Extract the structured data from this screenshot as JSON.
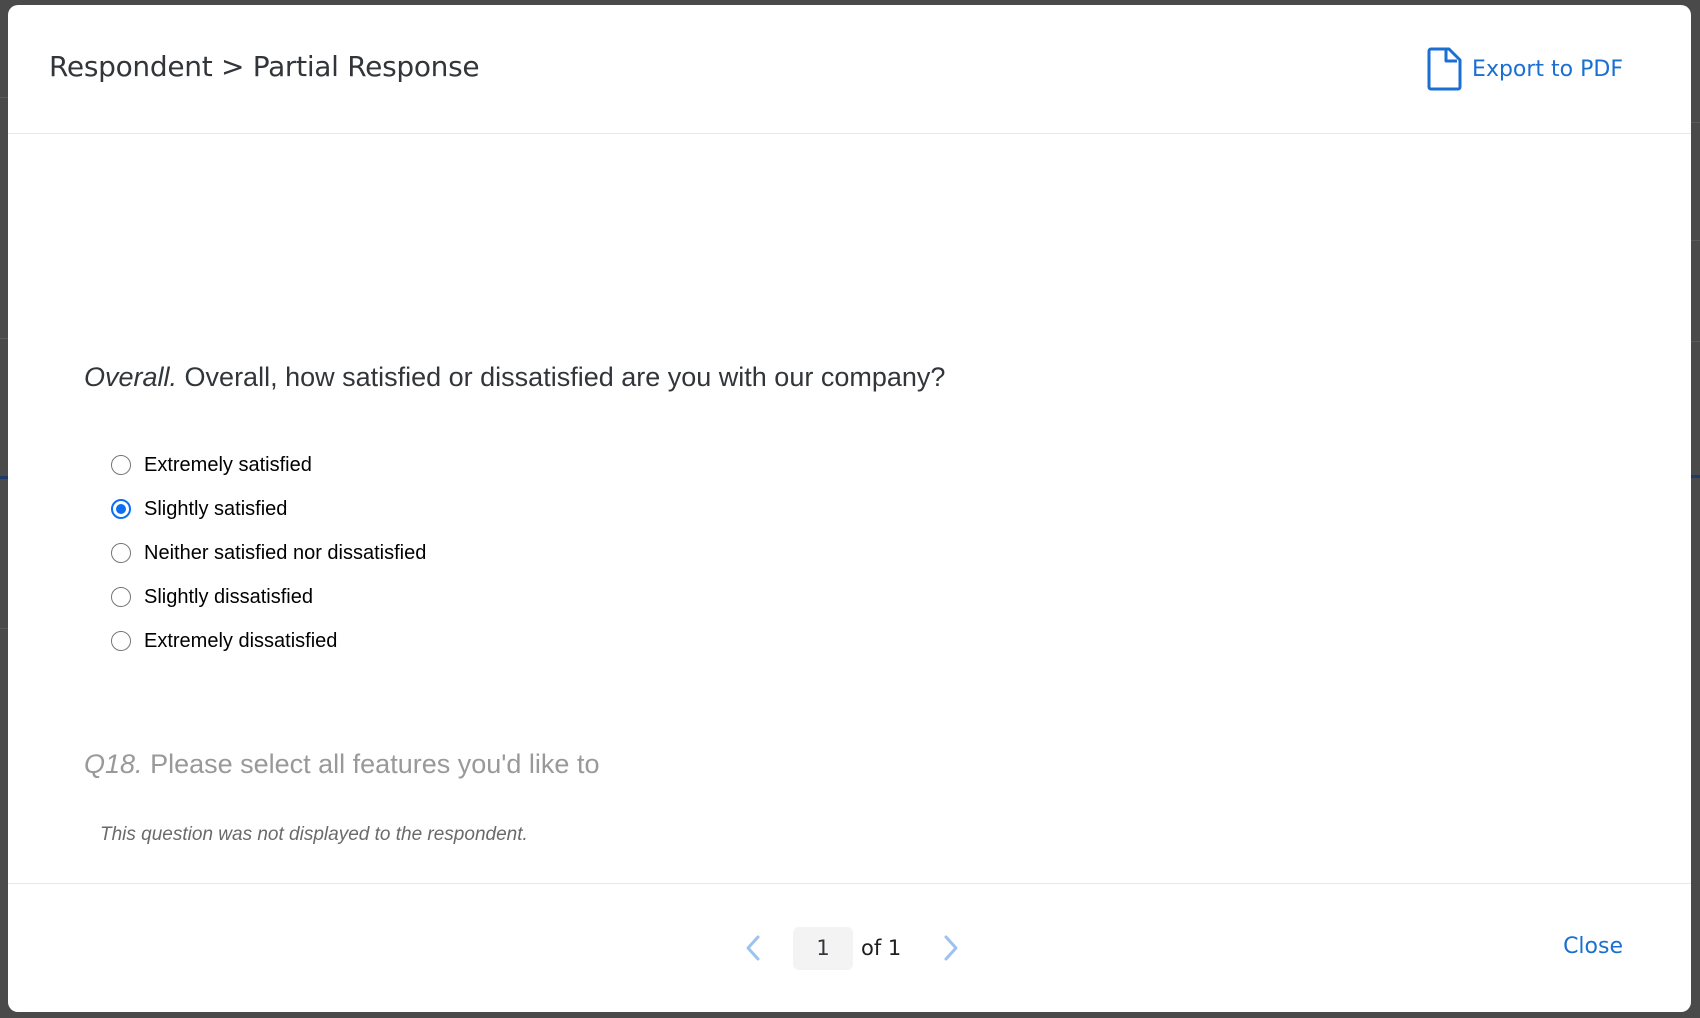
{
  "modal": {
    "title": "Respondent > Partial Response",
    "export_label": "Export to PDF",
    "export_icon": "document-icon",
    "close_label": "Close"
  },
  "questions": [
    {
      "id": "Overall.",
      "text": "Overall, how satisfied or dissatisfied are you with our company?",
      "type": "single-choice",
      "choices": [
        {
          "label": "Extremely satisfied",
          "selected": false
        },
        {
          "label": "Slightly satisfied",
          "selected": true
        },
        {
          "label": "Neither satisfied nor dissatisfied",
          "selected": false
        },
        {
          "label": "Slightly dissatisfied",
          "selected": false
        },
        {
          "label": "Extremely dissatisfied",
          "selected": false
        }
      ]
    },
    {
      "id": "Q18.",
      "text": "Please select all features you'd like to",
      "displayed": false,
      "note": "This question was not displayed to the respondent."
    }
  ],
  "pagination": {
    "current_page": "1",
    "of_label": "of 1",
    "prev_icon": "chevron-left-icon",
    "next_icon": "chevron-right-icon"
  },
  "colors": {
    "accent": "#1a6fd1",
    "radio_selected": "#0b6ef5",
    "overlay": "#4a4a4a",
    "disabled_chevron": "#9cc3f0"
  }
}
